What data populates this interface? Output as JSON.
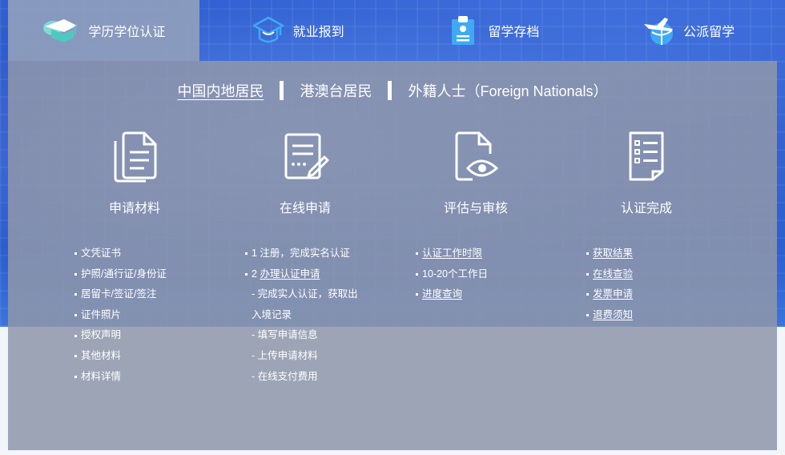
{
  "tabs": [
    {
      "label": "学历学位认证",
      "icon": "graduation-cap-icon",
      "active": true
    },
    {
      "label": "就业报到",
      "icon": "cap-outline-icon",
      "active": false
    },
    {
      "label": "留学存档",
      "icon": "archive-document-icon",
      "active": false
    },
    {
      "label": "公派留学",
      "icon": "airplane-globe-icon",
      "active": false
    }
  ],
  "subnav": {
    "mainland": "中国内地居民",
    "hkmt": "港澳台居民",
    "foreign": "外籍人士（Foreign Nationals）"
  },
  "steps": [
    {
      "title": "申请材料",
      "icon": "documents-icon"
    },
    {
      "title": "在线申请",
      "icon": "form-pen-icon"
    },
    {
      "title": "评估与审核",
      "icon": "document-eye-icon"
    },
    {
      "title": "认证完成",
      "icon": "checklist-icon"
    }
  ],
  "materials": [
    "文凭证书",
    "护照/通行证/身份证",
    "居留卡/签证/签注",
    "证件照片",
    "授权声明",
    "其他材料",
    "材料详情"
  ],
  "online": {
    "step1": "1 注册，完成实名认证",
    "step2_prefix": "2 ",
    "step2_link": "办理认证申请",
    "sub1a": "- 完成实人认证，获取出",
    "sub1b": "入境记录",
    "sub2": "- 填写申请信息",
    "sub3": "- 上传申请材料",
    "sub4": "- 在线支付费用"
  },
  "review": {
    "time_link": "认证工作时限",
    "duration": "10-20个工作日",
    "progress_link": "进度查询"
  },
  "complete": [
    "获取结果",
    "在线查验",
    "发票申请",
    "退费须知"
  ],
  "colors": {
    "panel": "#8f96aa",
    "bg_blue": "#2a55c6",
    "icon_teal": "#4fc9c0",
    "icon_blue": "#2f7fe8"
  }
}
